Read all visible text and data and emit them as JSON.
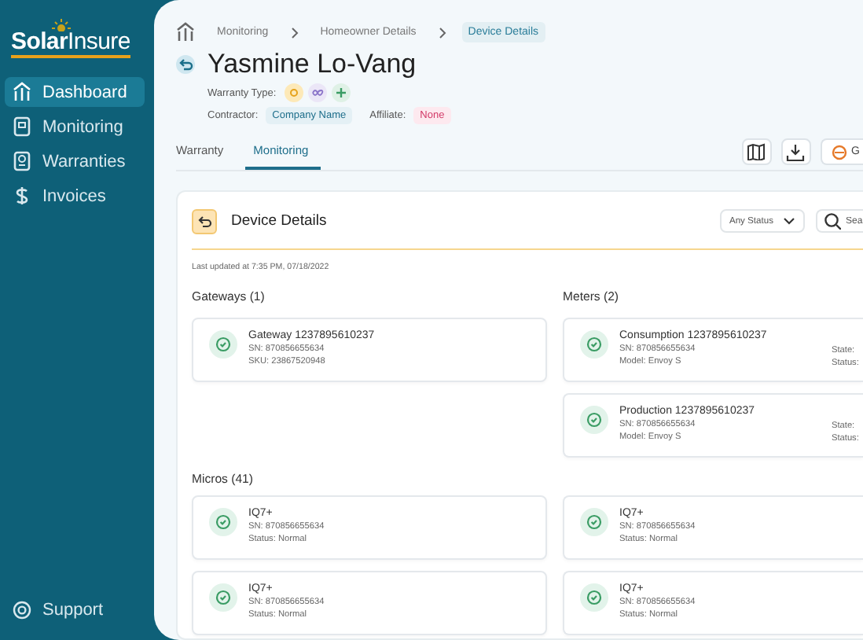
{
  "sidebar": {
    "logo_parts": [
      "Solar",
      "Insure"
    ],
    "items": [
      {
        "label": "Dashboard",
        "selected": true
      },
      {
        "label": "Monitoring",
        "selected": false
      },
      {
        "label": "Warranties",
        "selected": false
      },
      {
        "label": "Invoices",
        "selected": false
      }
    ],
    "footer": {
      "label": "Support"
    }
  },
  "breadcrumb": [
    {
      "label": "Monitoring",
      "selected": false
    },
    {
      "label": "Homeowner Details",
      "selected": false
    },
    {
      "label": "Device Details",
      "selected": true
    }
  ],
  "header": {
    "name": "Yasmine Lo-Vang",
    "warranty_type_label": "Warranty Type:",
    "contractor_label": "Contractor:",
    "contractor": "Company Name",
    "affiliate_label": "Affiliate:",
    "affiliate": "None"
  },
  "tabs": [
    {
      "label": "Warranty",
      "selected": false
    },
    {
      "label": "Monitoring",
      "selected": true
    }
  ],
  "actions": [
    {
      "kind": "map"
    },
    {
      "kind": "download"
    },
    {
      "kind": "labeled",
      "label": "G"
    }
  ],
  "panel": {
    "title": "Device Details",
    "status_filter": "Any Status",
    "search": {
      "placeholder": "Sea"
    },
    "last_updated": "Last updated at 7:35 PM, 07/18/2022"
  },
  "gateways": {
    "title": "Gateways (1)",
    "items": [
      {
        "name": "Gateway 1237895610237",
        "lines": [
          "SN: 870856655634",
          "SKU: 23867520948"
        ]
      }
    ]
  },
  "meters": {
    "title": "Meters (2)",
    "items": [
      {
        "name": "Consumption 1237895610237",
        "lines": [
          "SN: 870856655634",
          "Model: Envoy S"
        ],
        "side": [
          "State:",
          "Status:"
        ]
      },
      {
        "name": "Production 1237895610237",
        "lines": [
          "SN: 870856655634",
          "Model: Envoy S"
        ],
        "side": [
          "State:",
          "Status:"
        ]
      }
    ]
  },
  "micros": {
    "title": "Micros (41)",
    "items": [
      {
        "name": "IQ7+",
        "lines": [
          "SN: 870856655634",
          "Status: Normal"
        ]
      },
      {
        "name": "IQ7+",
        "lines": [
          "SN: 870856655634",
          "Status: Normal"
        ]
      },
      {
        "name": "IQ7+",
        "lines": [
          "SN: 870856655634",
          "Status: Normal"
        ]
      },
      {
        "name": "IQ7+",
        "lines": [
          "SN: 870856655634",
          "Status: Normal"
        ]
      }
    ]
  }
}
